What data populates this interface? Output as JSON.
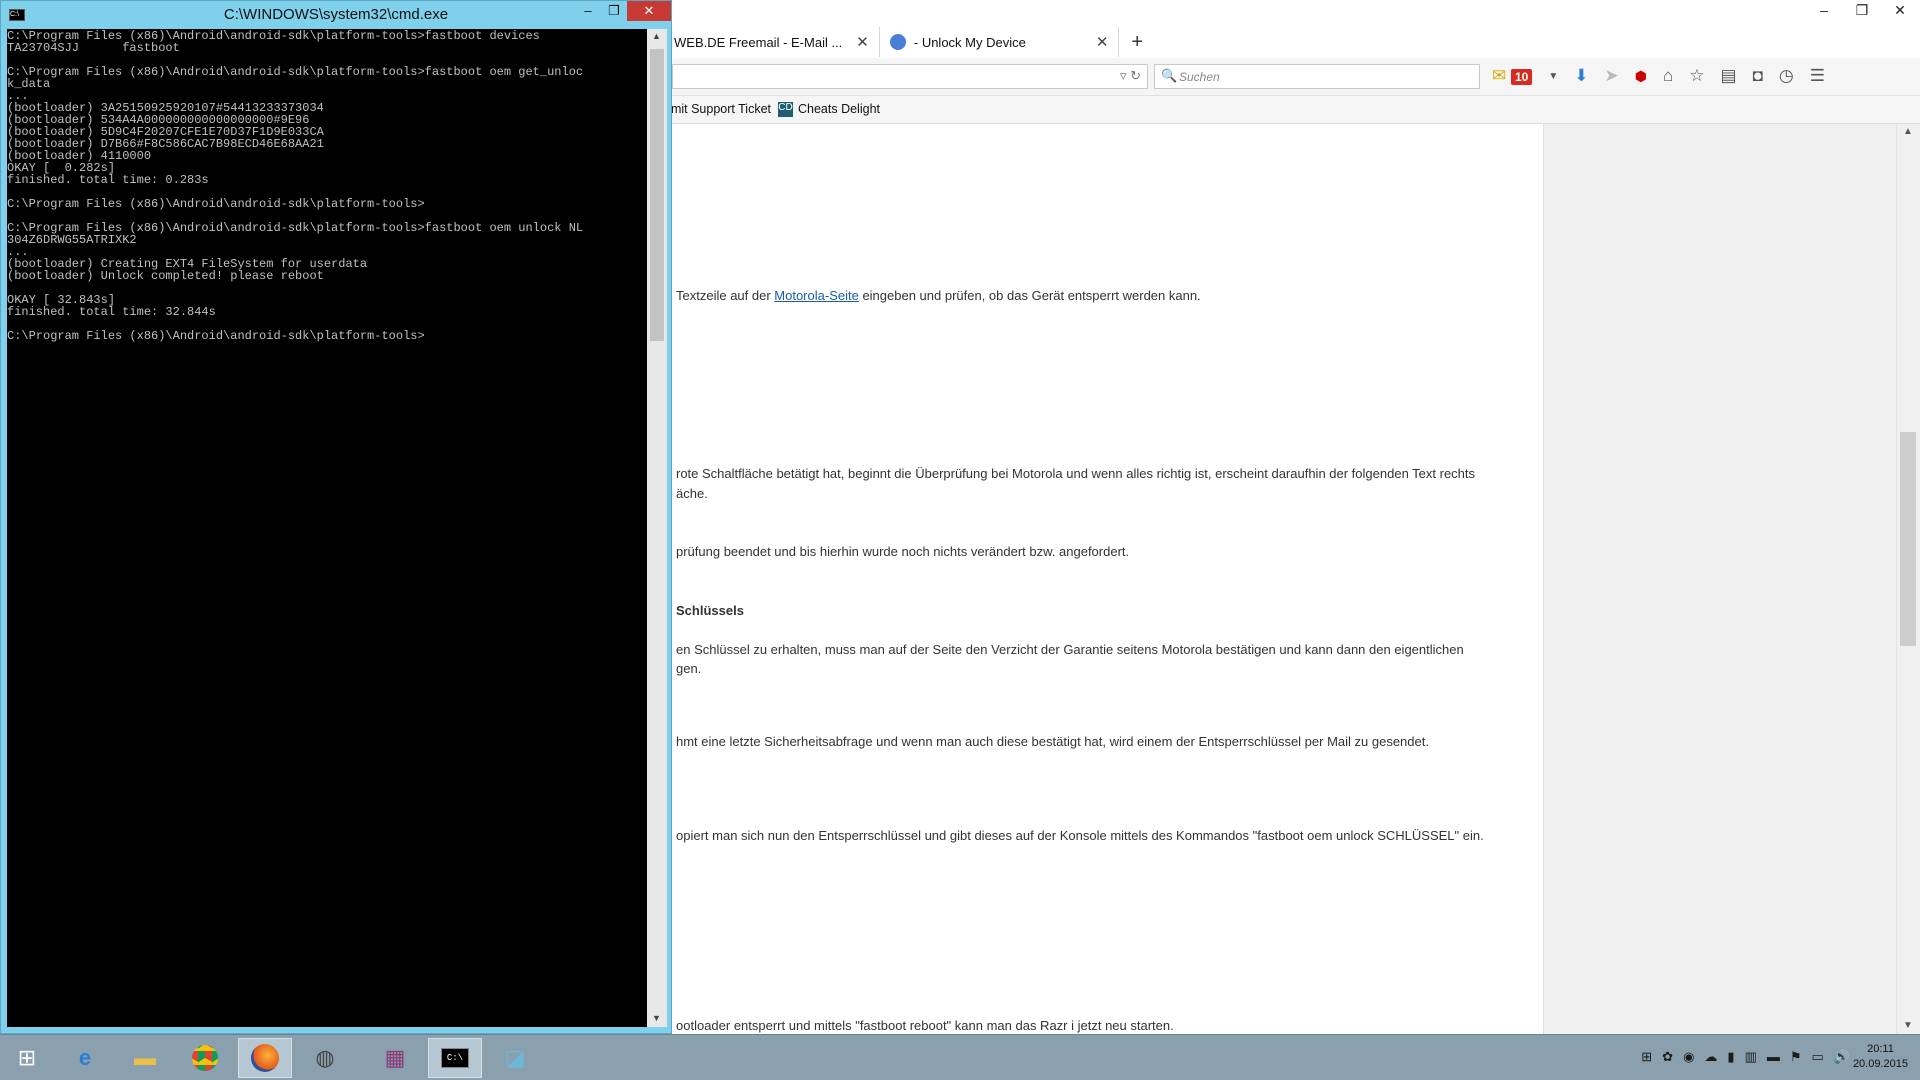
{
  "firefox": {
    "tabs": [
      {
        "label": "WEB.DE Freemail - E-Mail ...",
        "icon": "webde-icon"
      },
      {
        "label": "- Unlock My Device",
        "icon": "motorola-icon"
      }
    ],
    "search_placeholder": "Suchen",
    "mail_count": "10",
    "bookmarks": [
      {
        "label": "omit Support Ticket"
      },
      {
        "label": "Cheats Delight",
        "icon_text": "CD"
      }
    ],
    "page_lines": [
      {
        "pre": " Textzeile auf der ",
        "link": "Motorola-Seite",
        "post": " eingeben und prüfen, ob das Gerät entsperrt werden kann."
      },
      {
        "pre": " rote Schaltfläche betätigt hat, beginnt die Überprüfung bei Motorola und wenn alles richtig ist, erscheint daraufhin der folgenden Text rechts"
      },
      {
        "pre": "äche."
      },
      {
        "pre": "prüfung beendet und bis hierhin wurde noch nichts verändert bzw. angefordert."
      },
      {
        "pre": " Schlüssels",
        "bold": true
      },
      {
        "pre": "en Schlüssel zu erhalten, muss man auf der Seite den Verzicht der Garantie seitens Motorola bestätigen und kann dann den eigentlichen"
      },
      {
        "pre": "gen."
      },
      {
        "pre": "hmt eine letzte Sicherheitsabfrage und wenn man auch diese bestätigt hat, wird einem der Entsperrschlüssel per Mail zu gesendet."
      },
      {
        "pre": "opiert man sich nun den Entsperrschlüssel und gibt dieses auf der Konsole mittels des Kommandos \"fastboot oem unlock SCHLÜSSEL\" ein."
      },
      {
        "pre": "ootloader entsperrt und mittels \"fastboot reboot\" kann man das Razr i jetzt neu starten."
      }
    ]
  },
  "cmd": {
    "title": "C:\\WINDOWS\\system32\\cmd.exe",
    "icon_text": "C:\\",
    "lines": [
      "C:\\Program Files (x86)\\Android\\android-sdk\\platform-tools>fastboot devices",
      "TA23704SJJ      fastboot",
      "",
      "C:\\Program Files (x86)\\Android\\android-sdk\\platform-tools>fastboot oem get_unloc",
      "k_data",
      "...",
      "(bootloader) 3A25150925920107#54413233373034",
      "(bootloader) 534A4A000000000000000000#9E96",
      "(bootloader) 5D9C4F20207CFE1E70D37F1D9E033CA",
      "(bootloader) D7B66#F8C586CAC7B98ECD46E68AA21",
      "(bootloader) 4110000",
      "OKAY [  0.282s]",
      "finished. total time: 0.283s",
      "",
      "C:\\Program Files (x86)\\Android\\android-sdk\\platform-tools>",
      "",
      "C:\\Program Files (x86)\\Android\\android-sdk\\platform-tools>fastboot oem unlock NL",
      "304Z6DRWG55ATRIXK2",
      "...",
      "(bootloader) Creating EXT4 FileSystem for userdata",
      "(bootloader) Unlock completed! please reboot",
      "",
      "OKAY [ 32.843s]",
      "finished. total time: 32.844s",
      "",
      "C:\\Program Files (x86)\\Android\\android-sdk\\platform-tools>"
    ]
  },
  "taskbar": {
    "time": "20:11",
    "date": "20.09.2015"
  }
}
